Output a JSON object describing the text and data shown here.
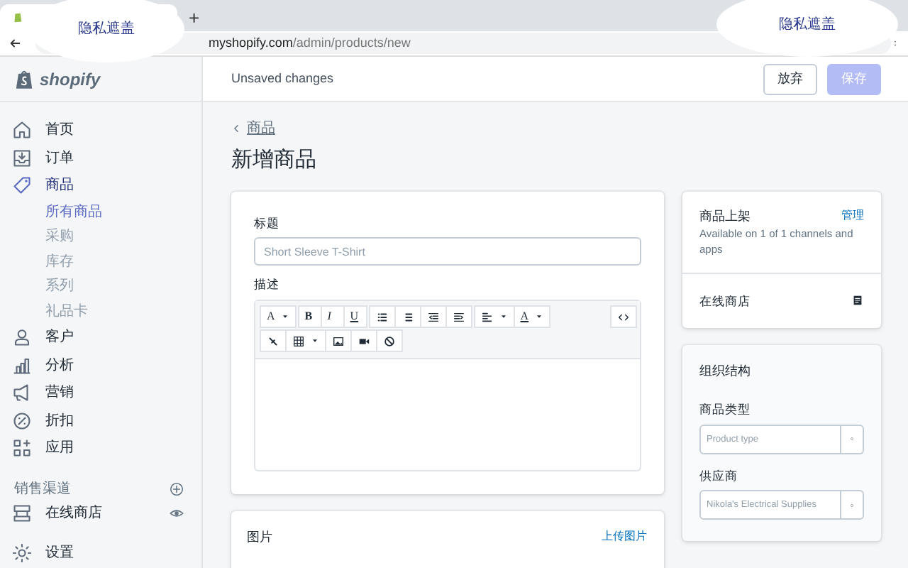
{
  "browser": {
    "new_tab": "+",
    "url_host": "myshopify.com",
    "url_path": "/admin/products/new"
  },
  "privacy_masks": [
    {
      "text": "隐私遮盖"
    },
    {
      "text": "隐私遮盖"
    }
  ],
  "header": {
    "logo": "shopify",
    "status": "Unsaved changes",
    "buttons": [
      {
        "label": "放弃",
        "kind": "secondary",
        "disabled": false
      },
      {
        "label": "保存",
        "kind": "primary",
        "disabled": true
      }
    ]
  },
  "sidebar": {
    "items": [
      {
        "label": "首页",
        "kind": "home",
        "selected": false
      },
      {
        "label": "订单",
        "kind": "orders",
        "selected": false
      },
      {
        "label": "商品",
        "kind": "products",
        "selected": true,
        "children": [
          {
            "label": "所有商品",
            "selected": true
          },
          {
            "label": "采购",
            "selected": false
          },
          {
            "label": "库存",
            "selected": false
          },
          {
            "label": "系列",
            "selected": false
          },
          {
            "label": "礼品卡",
            "selected": false
          }
        ]
      },
      {
        "label": "客户",
        "kind": "customers",
        "selected": false
      },
      {
        "label": "分析",
        "kind": "analytics",
        "selected": false
      },
      {
        "label": "营销",
        "kind": "marketing",
        "selected": false
      },
      {
        "label": "折扣",
        "kind": "discounts",
        "selected": false
      },
      {
        "label": "应用",
        "kind": "apps",
        "selected": false
      }
    ],
    "section_title": "销售渠道",
    "channels": [
      {
        "label": "在线商店",
        "kind": "store",
        "selected": false
      }
    ],
    "bottom_items": [
      {
        "label": "设置",
        "kind": "settings",
        "selected": false
      }
    ]
  },
  "breadcrumb": "商品",
  "page_title": "新增商品",
  "product_card": {
    "title_label": "标题",
    "title_placeholder": "Short Sleeve T-Shirt",
    "description_label": "描述",
    "toolbar_rows": [
      [
        [
          {
            "kind": "font",
            "label": "A",
            "dropdown": true
          }
        ],
        [
          {
            "kind": "bold",
            "label": "B"
          },
          {
            "kind": "italic",
            "label": "I"
          },
          {
            "kind": "underline",
            "label": "U"
          }
        ],
        [
          {
            "kind": "bullets"
          },
          {
            "kind": "numbers"
          },
          {
            "kind": "outdent"
          },
          {
            "kind": "indent"
          }
        ],
        [
          {
            "kind": "align",
            "dropdown": true
          },
          {
            "kind": "color",
            "label": "A",
            "dropdown": true
          }
        ],
        [
          {
            "kind": "code"
          }
        ]
      ],
      [
        [
          {
            "kind": "link"
          },
          {
            "kind": "table",
            "dropdown": true
          },
          {
            "kind": "image"
          },
          {
            "kind": "video"
          },
          {
            "kind": "clear"
          }
        ]
      ]
    ]
  },
  "images_card": {
    "title": "图片",
    "action": "上传图片"
  },
  "availability_card": {
    "title": "商品上架",
    "action": "管理",
    "text": "Available on 1 of 1 channels and apps",
    "channels": [
      "在线商店"
    ]
  },
  "organization_card": {
    "title": "组织结构",
    "fields": [
      {
        "label": "商品类型",
        "placeholder": "Product type"
      },
      {
        "label": "供应商",
        "placeholder": "Nikola's Electrical Supplies"
      }
    ]
  }
}
